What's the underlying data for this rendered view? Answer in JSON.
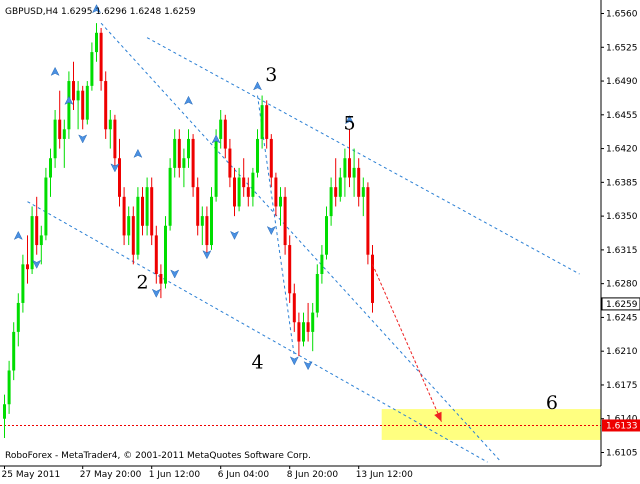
{
  "window": {
    "header": "GBPUSD,H4  1.6295 1.6296 1.6248 1.6259",
    "footer": "RoboForex - MetaTrader4, © 2001-2011 MetaQuotes Software Corp."
  },
  "colors": {
    "background": "#ffffff",
    "bull_candle": "#00dd00",
    "bear_candle": "#ee0000",
    "fractal": "#4a90e2",
    "trendline": "#2a7fd4",
    "target_zone": "#ffff80",
    "forecast_arrow": "#ee2222",
    "support_line": "#ee0000"
  },
  "chart_data": {
    "type": "candlestick",
    "symbol": "GBPUSD",
    "timeframe": "H4",
    "ohlc_header": {
      "open": 1.6295,
      "high": 1.6296,
      "low": 1.6248,
      "close": 1.6259
    },
    "ylim": [
      1.6091,
      1.6574
    ],
    "y_ticks": [
      "1.6560",
      "1.6525",
      "1.6490",
      "1.6455",
      "1.6420",
      "1.6385",
      "1.6350",
      "1.6315",
      "1.6280",
      "1.6245",
      "1.6210",
      "1.6175",
      "1.6140",
      "1.6105"
    ],
    "x_tick_labels": [
      {
        "label": "25 May 2011",
        "bar": 0
      },
      {
        "label": "27 May 20:00",
        "bar": 17
      },
      {
        "label": "1 Jun 12:00",
        "bar": 32
      },
      {
        "label": "6 Jun 04:00",
        "bar": 47
      },
      {
        "label": "8 Jun 20:00",
        "bar": 62
      },
      {
        "label": "13 Jun 12:00",
        "bar": 77
      }
    ],
    "current_price": {
      "label": "1.6259",
      "value": 1.6259
    },
    "support_level": {
      "label": "1.6133",
      "value": 1.6133
    },
    "candles": [
      [
        1.614,
        1.6165,
        1.612,
        1.6155
      ],
      [
        1.6155,
        1.62,
        1.6145,
        1.619
      ],
      [
        1.619,
        1.624,
        1.618,
        1.623
      ],
      [
        1.623,
        1.627,
        1.6215,
        1.626
      ],
      [
        1.626,
        1.631,
        1.625,
        1.63
      ],
      [
        1.63,
        1.633,
        1.628,
        1.6295
      ],
      [
        1.6295,
        1.636,
        1.629,
        1.635
      ],
      [
        1.635,
        1.637,
        1.631,
        1.632
      ],
      [
        1.632,
        1.634,
        1.63,
        1.633
      ],
      [
        1.633,
        1.64,
        1.6325,
        1.639
      ],
      [
        1.639,
        1.642,
        1.637,
        1.641
      ],
      [
        1.641,
        1.646,
        1.64,
        1.645
      ],
      [
        1.645,
        1.648,
        1.642,
        1.643
      ],
      [
        1.643,
        1.645,
        1.64,
        1.644
      ],
      [
        1.644,
        1.65,
        1.643,
        1.649
      ],
      [
        1.649,
        1.651,
        1.646,
        1.647
      ],
      [
        1.647,
        1.649,
        1.644,
        1.648
      ],
      [
        1.648,
        1.6485,
        1.644,
        1.645
      ],
      [
        1.645,
        1.649,
        1.6445,
        1.6485
      ],
      [
        1.6485,
        1.653,
        1.648,
        1.652
      ],
      [
        1.652,
        1.655,
        1.651,
        1.654
      ],
      [
        1.654,
        1.6545,
        1.648,
        1.649
      ],
      [
        1.649,
        1.65,
        1.643,
        1.644
      ],
      [
        1.644,
        1.646,
        1.642,
        1.645
      ],
      [
        1.645,
        1.6455,
        1.64,
        1.641
      ],
      [
        1.641,
        1.643,
        1.636,
        1.637
      ],
      [
        1.637,
        1.638,
        1.632,
        1.633
      ],
      [
        1.633,
        1.636,
        1.632,
        1.635
      ],
      [
        1.635,
        1.636,
        1.63,
        1.631
      ],
      [
        1.631,
        1.638,
        1.6305,
        1.637
      ],
      [
        1.637,
        1.638,
        1.633,
        1.634
      ],
      [
        1.634,
        1.639,
        1.633,
        1.638
      ],
      [
        1.638,
        1.639,
        1.632,
        1.633
      ],
      [
        1.633,
        1.634,
        1.628,
        1.629
      ],
      [
        1.629,
        1.63,
        1.6265,
        1.628
      ],
      [
        1.628,
        1.635,
        1.6275,
        1.634
      ],
      [
        1.634,
        1.641,
        1.6335,
        1.64
      ],
      [
        1.64,
        1.644,
        1.639,
        1.643
      ],
      [
        1.643,
        1.644,
        1.639,
        1.64
      ],
      [
        1.64,
        1.642,
        1.638,
        1.641
      ],
      [
        1.641,
        1.644,
        1.64,
        1.643
      ],
      [
        1.643,
        1.6435,
        1.637,
        1.638
      ],
      [
        1.638,
        1.639,
        1.633,
        1.634
      ],
      [
        1.634,
        1.636,
        1.632,
        1.635
      ],
      [
        1.635,
        1.636,
        1.631,
        1.632
      ],
      [
        1.632,
        1.638,
        1.6315,
        1.637
      ],
      [
        1.637,
        1.644,
        1.6365,
        1.643
      ],
      [
        1.643,
        1.646,
        1.642,
        1.645
      ],
      [
        1.645,
        1.6455,
        1.641,
        1.642
      ],
      [
        1.642,
        1.643,
        1.638,
        1.639
      ],
      [
        1.639,
        1.64,
        1.635,
        1.636
      ],
      [
        1.636,
        1.64,
        1.6355,
        1.639
      ],
      [
        1.639,
        1.641,
        1.637,
        1.638
      ],
      [
        1.638,
        1.639,
        1.636,
        1.637
      ],
      [
        1.637,
        1.64,
        1.636,
        1.6395
      ],
      [
        1.6395,
        1.644,
        1.639,
        1.643
      ],
      [
        1.643,
        1.6475,
        1.642,
        1.6465
      ],
      [
        1.6465,
        1.647,
        1.642,
        1.643
      ],
      [
        1.643,
        1.6435,
        1.638,
        1.639
      ],
      [
        1.639,
        1.6395,
        1.635,
        1.636
      ],
      [
        1.636,
        1.638,
        1.634,
        1.637
      ],
      [
        1.637,
        1.638,
        1.631,
        1.632
      ],
      [
        1.632,
        1.633,
        1.626,
        1.627
      ],
      [
        1.627,
        1.628,
        1.623,
        1.624
      ],
      [
        1.624,
        1.625,
        1.6205,
        1.622
      ],
      [
        1.622,
        1.625,
        1.6215,
        1.624
      ],
      [
        1.624,
        1.626,
        1.622,
        1.623
      ],
      [
        1.623,
        1.626,
        1.621,
        1.625
      ],
      [
        1.625,
        1.63,
        1.6245,
        1.629
      ],
      [
        1.629,
        1.632,
        1.628,
        1.631
      ],
      [
        1.631,
        1.636,
        1.6305,
        1.635
      ],
      [
        1.635,
        1.639,
        1.634,
        1.638
      ],
      [
        1.638,
        1.641,
        1.636,
        1.637
      ],
      [
        1.637,
        1.64,
        1.6365,
        1.639
      ],
      [
        1.639,
        1.642,
        1.637,
        1.641
      ],
      [
        1.641,
        1.644,
        1.638,
        1.639
      ],
      [
        1.639,
        1.642,
        1.637,
        1.64
      ],
      [
        1.64,
        1.641,
        1.636,
        1.637
      ],
      [
        1.637,
        1.639,
        1.635,
        1.638
      ],
      [
        1.638,
        1.6385,
        1.63,
        1.631
      ],
      [
        1.631,
        1.632,
        1.625,
        1.626
      ]
    ],
    "fractals": [
      {
        "bar": 3,
        "price": 1.633,
        "dir": "up"
      },
      {
        "bar": 7,
        "price": 1.63,
        "dir": "down"
      },
      {
        "bar": 11,
        "price": 1.65,
        "dir": "up"
      },
      {
        "bar": 14,
        "price": 1.647,
        "dir": "up"
      },
      {
        "bar": 17,
        "price": 1.643,
        "dir": "down"
      },
      {
        "bar": 20,
        "price": 1.6565,
        "dir": "up"
      },
      {
        "bar": 24,
        "price": 1.64,
        "dir": "down"
      },
      {
        "bar": 29,
        "price": 1.6415,
        "dir": "up"
      },
      {
        "bar": 33,
        "price": 1.627,
        "dir": "down"
      },
      {
        "bar": 37,
        "price": 1.629,
        "dir": "down"
      },
      {
        "bar": 40,
        "price": 1.647,
        "dir": "up"
      },
      {
        "bar": 44,
        "price": 1.631,
        "dir": "down"
      },
      {
        "bar": 46,
        "price": 1.643,
        "dir": "up"
      },
      {
        "bar": 50,
        "price": 1.633,
        "dir": "down"
      },
      {
        "bar": 55,
        "price": 1.6485,
        "dir": "up"
      },
      {
        "bar": 58,
        "price": 1.6335,
        "dir": "down"
      },
      {
        "bar": 63,
        "price": 1.62,
        "dir": "down"
      },
      {
        "bar": 66,
        "price": 1.6195,
        "dir": "down"
      },
      {
        "bar": 75,
        "price": 1.645,
        "dir": "up"
      }
    ],
    "trendlines": [
      {
        "from": [
          21,
          1.655
        ],
        "to": [
          108,
          1.6095
        ]
      },
      {
        "from": [
          31,
          1.6535
        ],
        "to": [
          125,
          1.629
        ]
      },
      {
        "from": [
          5,
          1.6365
        ],
        "to": [
          105,
          1.6095
        ]
      },
      {
        "from": [
          55,
          1.6475
        ],
        "to": [
          63,
          1.6205
        ]
      }
    ],
    "forecast_arrow": {
      "from": [
        80,
        1.63
      ],
      "to": [
        95,
        1.6137
      ]
    },
    "target_zone": {
      "bar_start": 82,
      "price_top": 1.615,
      "price_bottom": 1.6118
    },
    "wave_labels": [
      {
        "label": "2",
        "bar": 30,
        "price": 1.6275
      },
      {
        "label": "3",
        "bar": 58,
        "price": 1.649
      },
      {
        "label": "4",
        "bar": 55,
        "price": 1.6192
      },
      {
        "label": "5",
        "bar": 75,
        "price": 1.644
      },
      {
        "label": "6",
        "bar": 119,
        "price": 1.615
      }
    ]
  }
}
